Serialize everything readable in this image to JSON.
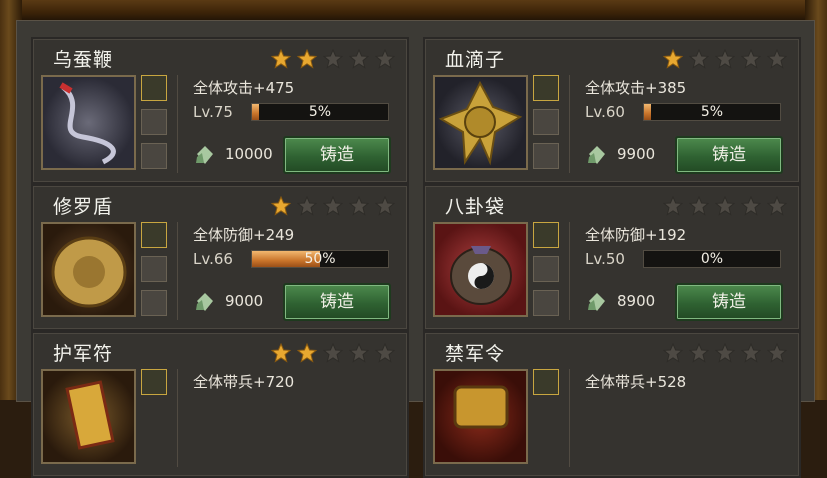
{
  "forge_label": "铸造",
  "items": [
    {
      "name": "乌蚕鞭",
      "stars_filled": 2,
      "stars_total": 5,
      "stat": "全体攻击+475",
      "level": "Lv.75",
      "progress_text": "5%",
      "progress": 0.05,
      "cost": "10000",
      "icon": "whip-icon"
    },
    {
      "name": "血滴子",
      "stars_filled": 1,
      "stars_total": 5,
      "stat": "全体攻击+385",
      "level": "Lv.60",
      "progress_text": "5%",
      "progress": 0.05,
      "cost": "9900",
      "icon": "blood-drop-weapon-icon"
    },
    {
      "name": "修罗盾",
      "stars_filled": 1,
      "stars_total": 5,
      "stat": "全体防御+249",
      "level": "Lv.66",
      "progress_text": "50%",
      "progress": 0.5,
      "cost": "9000",
      "icon": "shield-icon"
    },
    {
      "name": "八卦袋",
      "stars_filled": 0,
      "stars_total": 5,
      "stat": "全体防御+192",
      "level": "Lv.50",
      "progress_text": "0%",
      "progress": 0.0,
      "cost": "8900",
      "icon": "bagua-bag-icon"
    },
    {
      "name": "护军符",
      "stars_filled": 2,
      "stars_total": 5,
      "stat": "全体带兵+720",
      "icon": "talisman-icon"
    },
    {
      "name": "禁军令",
      "stars_filled": 0,
      "stars_total": 5,
      "stat": "全体带兵+528",
      "icon": "command-token-icon"
    }
  ]
}
